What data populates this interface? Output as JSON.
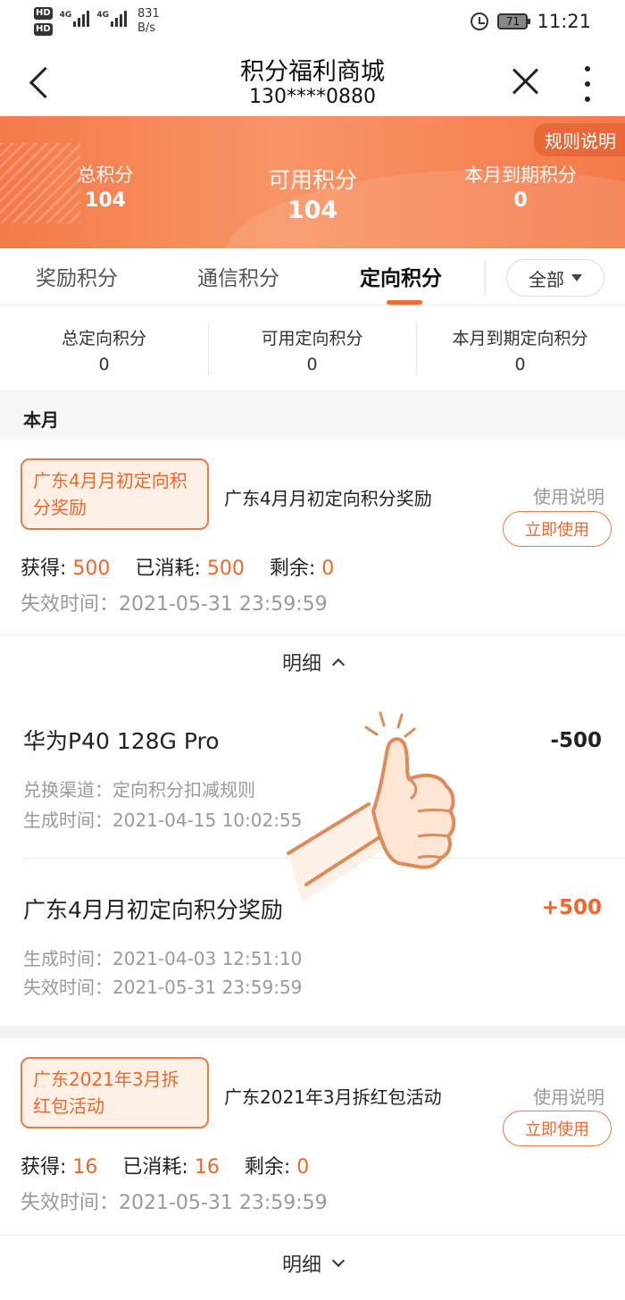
{
  "status_bar": {
    "hd1": "HD",
    "hd2": "HD",
    "net1": "4G",
    "net2": "4G",
    "speed_value": "831",
    "speed_unit": "B/s",
    "battery": "71",
    "time": "11:21"
  },
  "nav": {
    "title": "积分福利商城",
    "subtitle": "130****0880"
  },
  "banner": {
    "rules_label": "规则说明",
    "total_label": "总积分",
    "total_value": "104",
    "available_label": "可用积分",
    "available_value": "104",
    "expiring_label": "本月到期积分",
    "expiring_value": "0"
  },
  "tabs": {
    "items": [
      "奖励积分",
      "通信积分",
      "定向积分"
    ],
    "active": "定向积分",
    "filter_label": "全部"
  },
  "summary": {
    "total_label": "总定向积分",
    "total_value": "0",
    "available_label": "可用定向积分",
    "available_value": "0",
    "expiring_label": "本月到期定向积分",
    "expiring_value": "0"
  },
  "section_label": "本月",
  "cards": [
    {
      "tag": "广东4月月初定向积分奖励",
      "title": "广东4月月初定向积分奖励",
      "usage_label": "使用说明",
      "use_button": "立即使用",
      "gained_label": "获得:",
      "gained_value": "500",
      "consumed_label": "已消耗:",
      "consumed_value": "500",
      "remaining_label": "剩余:",
      "remaining_value": "0",
      "expiry": "失效时间：2021-05-31 23:59:59",
      "detail_toggle": "明细"
    },
    {
      "tag": "广东2021年3月拆红包活动",
      "title": "广东2021年3月拆红包活动",
      "usage_label": "使用说明",
      "use_button": "立即使用",
      "gained_label": "获得:",
      "gained_value": "16",
      "consumed_label": "已消耗:",
      "consumed_value": "16",
      "remaining_label": "剩余:",
      "remaining_value": "0",
      "expiry": "失效时间：2021-05-31 23:59:59",
      "detail_toggle": "明细"
    }
  ],
  "details": [
    {
      "name": "华为P40 128G Pro",
      "amount": "-500",
      "line1": "兑换渠道：定向积分扣减规则",
      "line2": "生成时间：2021-04-15 10:02:55"
    },
    {
      "name": "广东4月月初定向积分奖励",
      "amount": "+500",
      "line1": "生成时间：2021-04-03 12:51:10",
      "line2": "失效时间：2021-05-31 23:59:59"
    }
  ],
  "colors": {
    "accent": "#f0662c",
    "banner": "#f47a4a"
  },
  "icons": [
    "back-icon",
    "close-icon",
    "more-icon",
    "alarm-icon",
    "battery-icon",
    "thumbs-up-icon"
  ]
}
